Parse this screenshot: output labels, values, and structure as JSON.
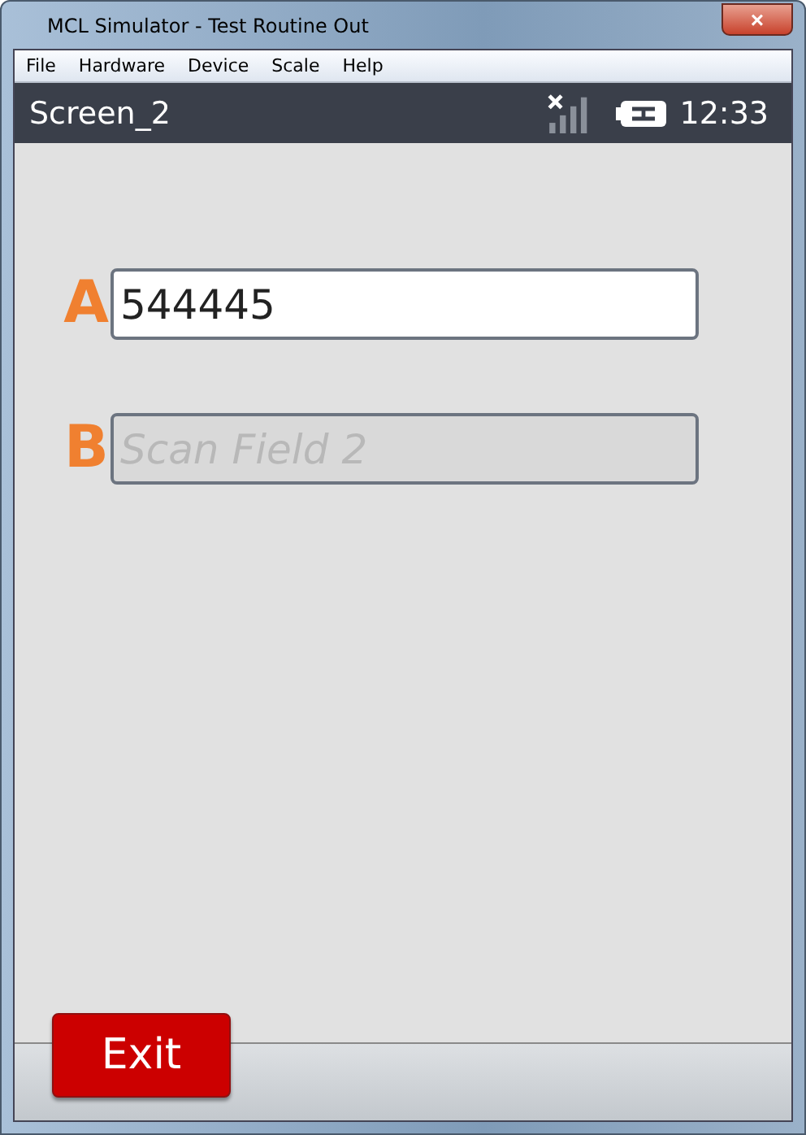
{
  "window": {
    "title": "MCL Simulator - Test Routine Out",
    "close": "×"
  },
  "menu": [
    "File",
    "Hardware",
    "Device",
    "Scale",
    "Help"
  ],
  "header": {
    "title": "Screen_2",
    "time": "12:33"
  },
  "fields": [
    {
      "label": "A",
      "value": "544445",
      "disabled": false
    },
    {
      "label": "B",
      "placeholder": "Scan Field 2",
      "disabled": true
    }
  ],
  "buttons": [
    "Exit"
  ]
}
